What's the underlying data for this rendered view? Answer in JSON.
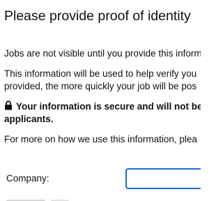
{
  "page": {
    "title": "Please provide proof of identity"
  },
  "content": {
    "para1_line1": "Jobs are not visible until you provide this inform",
    "para2_line1": "This information will be used to help verify you",
    "para2_line2": "provided, the more quickly your job will be pos",
    "secure_line1": "Your information is secure and will not be",
    "secure_line2": "applicants.",
    "para4_line1": "For more on how we use this information, plea"
  },
  "icons": {
    "lock": "lock-icon"
  },
  "form": {
    "company_label": "Company:",
    "company_value": ""
  },
  "colors": {
    "input_focus_border": "#1a6fd6",
    "text": "#111111"
  }
}
